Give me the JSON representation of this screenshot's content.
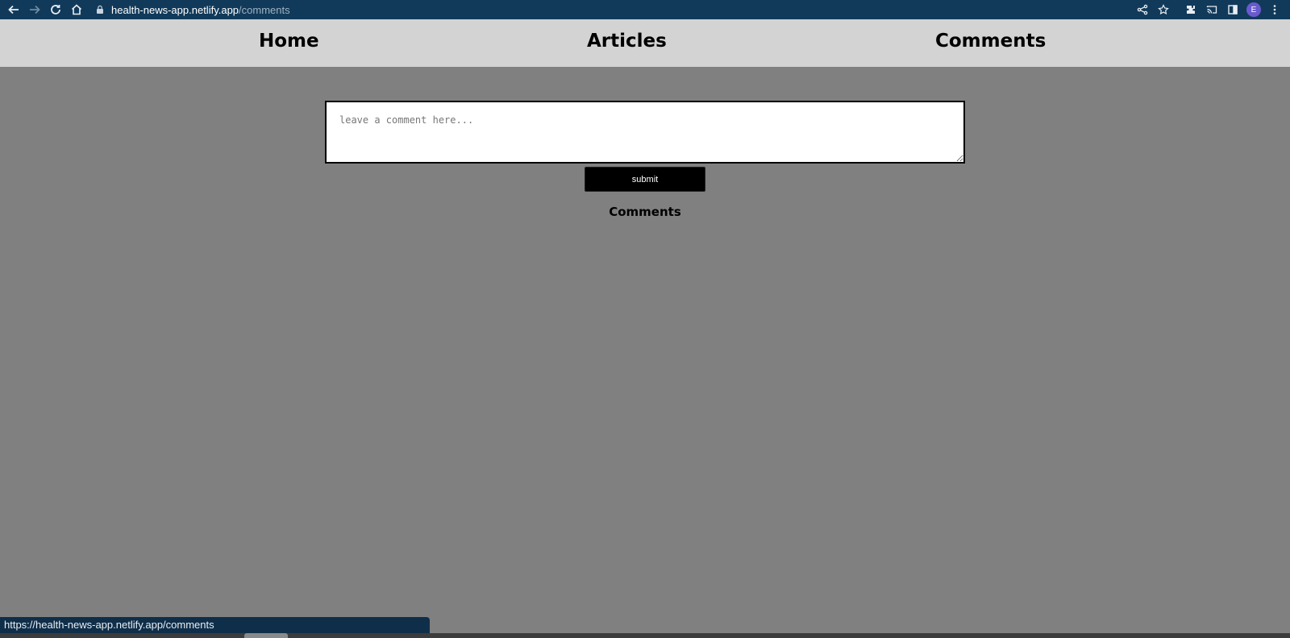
{
  "browser": {
    "url_host": "health-news-app.netlify.app",
    "url_path": "/comments",
    "profile_initial": "E",
    "status_url": "https://health-news-app.netlify.app/comments"
  },
  "nav": {
    "home": "Home",
    "articles": "Articles",
    "comments": "Comments"
  },
  "form": {
    "placeholder": "leave a comment here...",
    "value": "",
    "submit_label": "submit"
  },
  "comments_section": {
    "heading": "Comments",
    "items": []
  },
  "colors": {
    "browser_bar": "#113a5a",
    "nav_background": "#d3d3d3",
    "page_background": "#808080",
    "button_background": "#000000"
  }
}
